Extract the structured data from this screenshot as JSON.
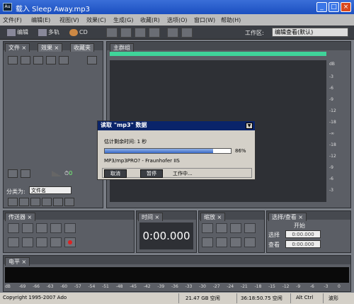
{
  "window": {
    "app_icon": "Au",
    "title": "载入 Sleep Away.mp3"
  },
  "menu": [
    "文件(F)",
    "编辑(E)",
    "视图(V)",
    "效果(C)",
    "生成(G)",
    "收藏(R)",
    "选项(O)",
    "窗口(W)",
    "帮助(H)"
  ],
  "toolbar": {
    "edit": "编辑",
    "multitrack": "多轨",
    "cd": "CD",
    "workspace_label": "工作区:",
    "workspace_value": "编辑查看(默认)"
  },
  "files_panel": {
    "tabs": [
      "文件",
      "效果",
      "收藏夹"
    ],
    "sort_label": "分类为:",
    "sort_value": "文件名",
    "counter": "0"
  },
  "main_panel": {
    "tab": "主群组"
  },
  "db_ruler": [
    "dB",
    "-3",
    "-6",
    "-9",
    "-12",
    "-18",
    "-∞",
    "-18",
    "-12",
    "-9",
    "-6",
    "-3"
  ],
  "dialog": {
    "title": "读取 \"mp3\" 数据",
    "remaining": "估计剩余时间: 1 秒",
    "percent": "86%",
    "progress": 0.86,
    "codec": "MP3/mp3PRO? - Fraunhofer IIS",
    "cancel": "取消",
    "pause": "暂停",
    "status": "工作中..."
  },
  "transport": {
    "tab": "传送器"
  },
  "time": {
    "tab": "时间",
    "value": "0:00.000"
  },
  "zoom": {
    "tab": "缩放"
  },
  "selection": {
    "tab": "选择/查看",
    "start_header": "开始",
    "select_label": "选择",
    "view_label": "查看",
    "select_start": "0:00.000",
    "view_start": "0:00.000"
  },
  "levels": {
    "tab": "电平",
    "scale": [
      "dB",
      "-69",
      "-66",
      "-63",
      "-60",
      "-57",
      "-54",
      "-51",
      "-48",
      "-45",
      "-42",
      "-39",
      "-36",
      "-33",
      "-30",
      "-27",
      "-24",
      "-21",
      "-18",
      "-15",
      "-12",
      "-9",
      "-6",
      "-3",
      "0"
    ]
  },
  "statusbar": {
    "copyright": "Copyright 1995-2007 Ado",
    "disk_free": "21.47 GB 空闲",
    "time_free": "36:18:50.75 空闲",
    "shortcut": "Alt Ctrl",
    "mode": "波形"
  },
  "colors": {
    "accent": "#3fd49a",
    "titlebar": "#1b4fc0",
    "dialog_title": "#0a246a"
  }
}
